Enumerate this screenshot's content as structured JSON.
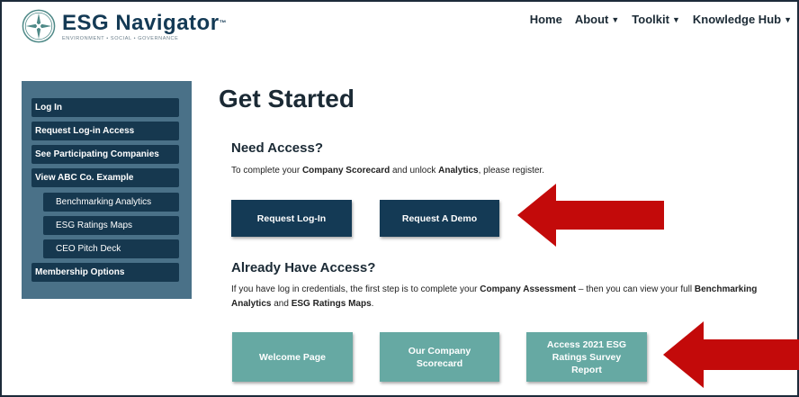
{
  "header": {
    "logo_title": "ESG Navigator",
    "logo_tm": "™",
    "logo_subtitle": "ENVIRONMENT • SOCIAL • GOVERNANCE",
    "nav": [
      {
        "label": "Home",
        "has_caret": false
      },
      {
        "label": "About",
        "has_caret": true
      },
      {
        "label": "Toolkit",
        "has_caret": true
      },
      {
        "label": "Knowledge Hub",
        "has_caret": true
      }
    ],
    "caret_glyph": "▼"
  },
  "sidebar": {
    "items": [
      {
        "label": "Log In"
      },
      {
        "label": "Request Log-in Access"
      },
      {
        "label": "See Participating Companies"
      },
      {
        "label": "View ABC Co. Example"
      },
      {
        "label": "Benchmarking Analytics"
      },
      {
        "label": "ESG Ratings Maps"
      },
      {
        "label": "CEO Pitch Deck"
      },
      {
        "label": "Membership Options"
      }
    ]
  },
  "main": {
    "title": "Get Started",
    "need_access": {
      "heading": "Need Access?",
      "text_1": "To complete your ",
      "bold_1": "Company Scorecard",
      "text_2": " and unlock ",
      "bold_2": "Analytics",
      "text_3": ", please register.",
      "buttons": [
        "Request Log-In",
        "Request A Demo"
      ]
    },
    "already_access": {
      "heading": "Already Have Access?",
      "text_1": "If you have log in credentials, the first step is to complete your ",
      "bold_1": "Company Assessment",
      "text_2": " – then you can view your full ",
      "bold_2": "Benchmarking Analytics",
      "text_3": " and ",
      "bold_3": "ESG Ratings Maps",
      "text_4": ".",
      "buttons": [
        "Welcome Page",
        "Our Company Scorecard",
        "Access 2021 ESG Ratings Survey Report"
      ]
    }
  },
  "colors": {
    "navy": "#143a55",
    "sidebar_bg": "#4a7188",
    "teal": "#66a9a3",
    "arrow_red": "#c30a0a"
  }
}
